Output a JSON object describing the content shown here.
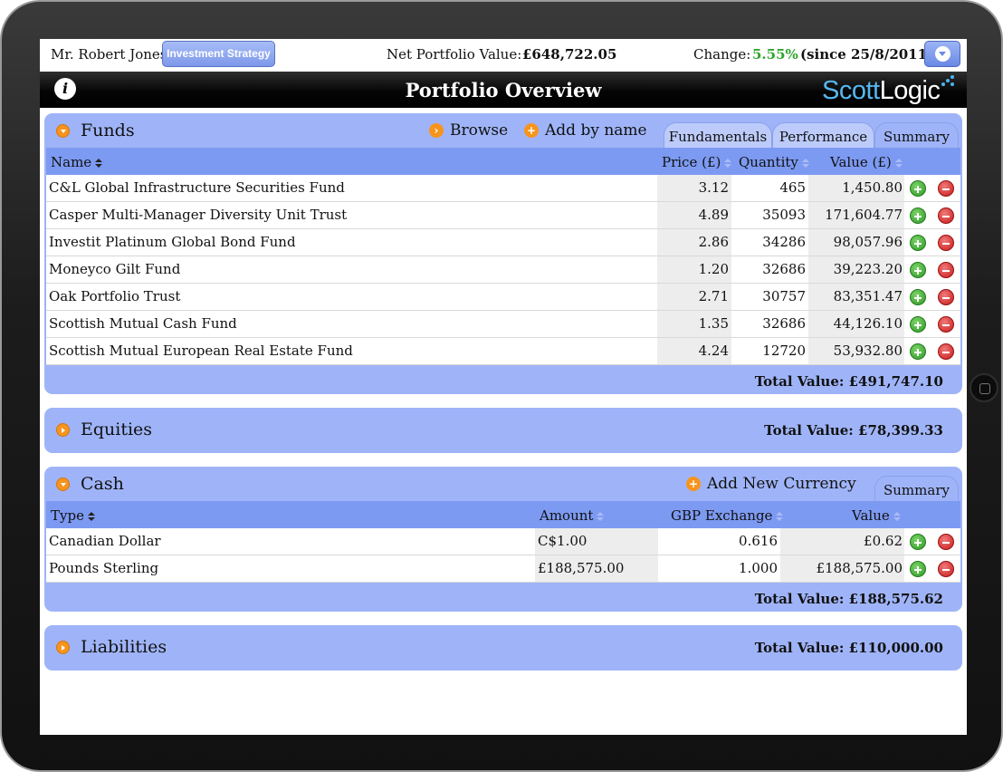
{
  "header": {
    "client_name": "Mr. Robert Jones",
    "strategy_button": "Investment Strategy",
    "net_label": "Net Portfolio Value:",
    "net_value": "£648,722.05",
    "change_label": "Change:",
    "change_value": "5.55%",
    "change_since": "(since 25/8/2011)"
  },
  "titlebar": {
    "info": "i",
    "title": "Portfolio Overview",
    "logo_part1": "Scott",
    "logo_part2": "Logic"
  },
  "colors": {
    "panel": "#9fb4f8",
    "grid_header": "#7d9af2",
    "change_positive": "#2ea52e",
    "accent_orange": "#f7941d"
  },
  "funds": {
    "title": "Funds",
    "browse": "Browse",
    "add_by_name": "Add by name",
    "tabs": [
      "Fundamentals",
      "Performance",
      "Summary"
    ],
    "columns": [
      "Name",
      "Price (£)",
      "Quantity",
      "Value (£)"
    ],
    "rows": [
      {
        "name": "C&L Global Infrastructure Securities Fund",
        "price": "3.12",
        "quantity": "465",
        "value": "1,450.80"
      },
      {
        "name": "Casper Multi-Manager Diversity Unit Trust",
        "price": "4.89",
        "quantity": "35093",
        "value": "171,604.77"
      },
      {
        "name": "Investit Platinum Global Bond Fund",
        "price": "2.86",
        "quantity": "34286",
        "value": "98,057.96"
      },
      {
        "name": "Moneyco Gilt Fund",
        "price": "1.20",
        "quantity": "32686",
        "value": "39,223.20"
      },
      {
        "name": "Oak Portfolio Trust",
        "price": "2.71",
        "quantity": "30757",
        "value": "83,351.47"
      },
      {
        "name": "Scottish Mutual Cash Fund",
        "price": "1.35",
        "quantity": "32686",
        "value": "44,126.10"
      },
      {
        "name": "Scottish Mutual European Real Estate Fund",
        "price": "4.24",
        "quantity": "12720",
        "value": "53,932.80"
      }
    ],
    "total": "Total Value: £491,747.10"
  },
  "equities": {
    "title": "Equities",
    "total": "Total Value: £78,399.33"
  },
  "cash": {
    "title": "Cash",
    "add_currency": "Add New Currency",
    "tab": "Summary",
    "columns": [
      "Type",
      "Amount",
      "GBP Exchange",
      "Value"
    ],
    "rows": [
      {
        "type": "Canadian Dollar",
        "amount": "C$1.00",
        "exchange": "0.616",
        "value": "£0.62"
      },
      {
        "type": "Pounds Sterling",
        "amount": "£188,575.00",
        "exchange": "1.000",
        "value": "£188,575.00"
      }
    ],
    "total": "Total Value: £188,575.62"
  },
  "liabilities": {
    "title": "Liabilities",
    "total": "Total Value: £110,000.00"
  }
}
